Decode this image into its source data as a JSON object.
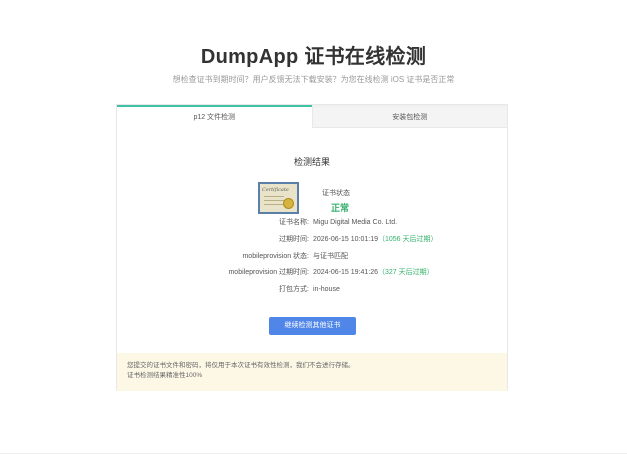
{
  "header": {
    "title": "DumpApp 证书在线检测",
    "subtitle": "想检查证书到期时间？用户反馈无法下载安装？为您在线检测 iOS 证书是否正常"
  },
  "tabs": [
    {
      "label": "p12 文件检测",
      "active": true
    },
    {
      "label": "安装包检测",
      "active": false
    }
  ],
  "result": {
    "title": "检测结果",
    "status_label": "证书状态",
    "status_value": "正常",
    "rows": [
      {
        "label": "证书名称:",
        "value": "Migu Digital Media Co. Ltd.",
        "note": ""
      },
      {
        "label": "过期时间:",
        "value": "2026-06-15 10:01:19",
        "note": "（1056 天后过期）"
      },
      {
        "label": "mobileprovision 状态:",
        "value": "与证书匹配",
        "note": ""
      },
      {
        "label": "mobileprovision 过期时间:",
        "value": "2024-06-15 19:41:26",
        "note": "（327 天后过期）"
      },
      {
        "label": "打包方式:",
        "value": "in-house",
        "note": ""
      }
    ],
    "continue_button": "继续检测其他证书"
  },
  "notice": {
    "line1": "您提交的证书文件和密码，将仅用于本次证书有效性检测，我们不会进行存储。",
    "line2": "证书检测结果精准性100%"
  },
  "colors": {
    "accent": "#3fc1a5",
    "ok_green": "#35b26b",
    "button_blue": "#4f86e8",
    "notice_bg": "#fdf8e6"
  },
  "icons": {
    "certificate": "certificate-icon"
  }
}
